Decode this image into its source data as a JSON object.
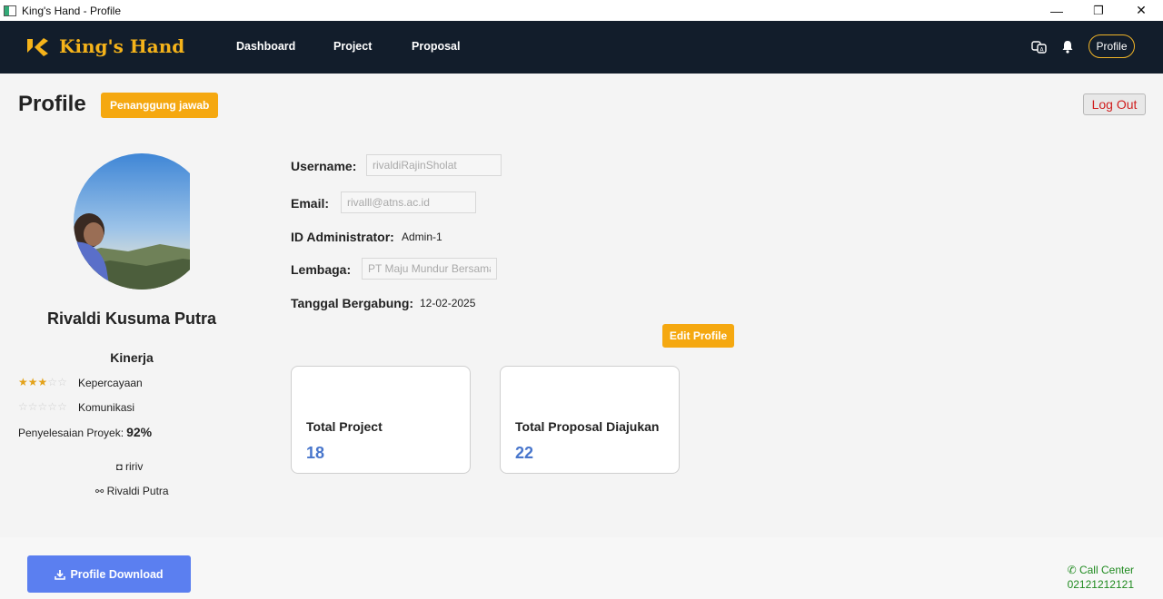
{
  "window": {
    "title": "King's Hand - Profile",
    "minimize": "—",
    "maximize": "❐",
    "close": "✕"
  },
  "nav": {
    "brand": "King's Hand",
    "links": [
      "Dashboard",
      "Project",
      "Proposal"
    ],
    "profile_label": "Profile",
    "accent": "#f5b31a",
    "background": "#121d2b"
  },
  "header": {
    "title": "Profile",
    "role_badge": "Penanggung jawab",
    "logout_label": "Log Out"
  },
  "user": {
    "full_name": "Rivaldi Kusuma Putra",
    "performance_title": "Kinerja",
    "ratings": [
      {
        "label": "Kepercayaan",
        "stars": 3,
        "max": 5
      },
      {
        "label": "Komunikasi",
        "stars": 0,
        "max": 5
      }
    ],
    "completion_label": "Penyelesaian Proyek:",
    "completion_value": "92%",
    "socials": [
      {
        "icon": "instagram-icon",
        "glyph": "◘",
        "value": "ririv"
      },
      {
        "icon": "link-icon",
        "glyph": "⚯",
        "value": "Rivaldi Putra"
      }
    ]
  },
  "details": {
    "username_label": "Username:",
    "username_value": "rivaldiRajinSholat",
    "email_label": "Email:",
    "email_value": "rivalll@atns.ac.id",
    "admin_id_label": "ID Administrator:",
    "admin_id_value": "Admin-1",
    "institution_label": "Lembaga:",
    "institution_value": "PT Maju Mundur Bersama",
    "join_date_label": "Tanggal Bergabung:",
    "join_date_value": "12-02-2025",
    "edit_label": "Edit Profile"
  },
  "stats": [
    {
      "label": "Total Project",
      "value": "18"
    },
    {
      "label": "Total Proposal Diajukan",
      "value": "22"
    }
  ],
  "footer": {
    "download_label": "Profile Download",
    "call_center_label": "Call Center",
    "call_center_number": "02121212121"
  }
}
